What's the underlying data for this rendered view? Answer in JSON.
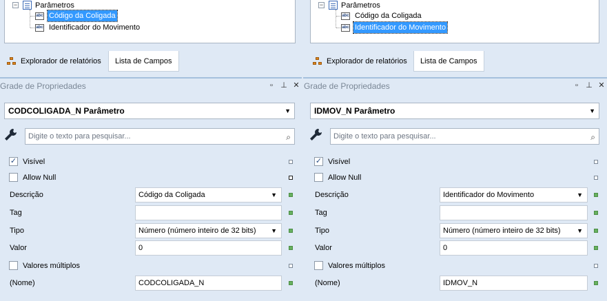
{
  "left": {
    "tree": {
      "parent_label": "Parâmetros",
      "items": [
        {
          "label": "Código da Coligada",
          "selected": true
        },
        {
          "label": "Identificador do Movimento",
          "selected": false
        }
      ]
    },
    "tabs": [
      {
        "label": "Explorador de relatórios",
        "icon": "report-explorer-icon",
        "active": false
      },
      {
        "label": "Lista de Campos",
        "active": true
      }
    ],
    "panel_title": "Grade de Propriedades",
    "object_selector": "CODCOLIGADA_N  Parâmetro",
    "search": {
      "placeholder": "Digite o texto para pesquisar..."
    },
    "props": {
      "visivel": {
        "label": "Visível",
        "checked": true
      },
      "allow_null": {
        "label": "Allow Null",
        "checked": false
      },
      "descricao": {
        "label": "Descrição",
        "value": "Código da Coligada"
      },
      "tag": {
        "label": "Tag",
        "value": ""
      },
      "tipo": {
        "label": "Tipo",
        "value": "Número (número inteiro de 32 bits)"
      },
      "valor": {
        "label": "Valor",
        "value": "0"
      },
      "multiplos": {
        "label": "Valores múltiplos",
        "checked": false
      },
      "nome": {
        "label": "(Nome)",
        "value": "CODCOLIGADA_N"
      }
    }
  },
  "right": {
    "tree": {
      "parent_label": "Parâmetros",
      "items": [
        {
          "label": "Código da Coligada",
          "selected": false
        },
        {
          "label": "Identificador do Movimento",
          "selected": true
        }
      ]
    },
    "tabs": [
      {
        "label": "Explorador de relatórios",
        "icon": "report-explorer-icon",
        "active": false
      },
      {
        "label": "Lista de Campos",
        "active": true
      }
    ],
    "panel_title": "Grade de Propriedades",
    "object_selector": "IDMOV_N  Parâmetro",
    "search": {
      "placeholder": "Digite o texto para pesquisar..."
    },
    "props": {
      "visivel": {
        "label": "Visível",
        "checked": true
      },
      "allow_null": {
        "label": "Allow Null",
        "checked": false
      },
      "descricao": {
        "label": "Descrição",
        "value": "Identificador do Movimento"
      },
      "tag": {
        "label": "Tag",
        "value": ""
      },
      "tipo": {
        "label": "Tipo",
        "value": "Número (número inteiro de 32 bits)"
      },
      "valor": {
        "label": "Valor",
        "value": "0"
      },
      "multiplos": {
        "label": "Valores múltiplos",
        "checked": false
      },
      "nome": {
        "label": "(Nome)",
        "value": "IDMOV_N"
      }
    }
  },
  "icons": {
    "window_position": "window-position-icon",
    "pin": "pin-icon",
    "close": "close-icon",
    "check": "✓",
    "search": "search-icon",
    "wrench": "wrench-icon"
  },
  "colors": {
    "background": "#dfe9f5",
    "selection": "#3399ff",
    "marker_green": "#67b05f"
  }
}
